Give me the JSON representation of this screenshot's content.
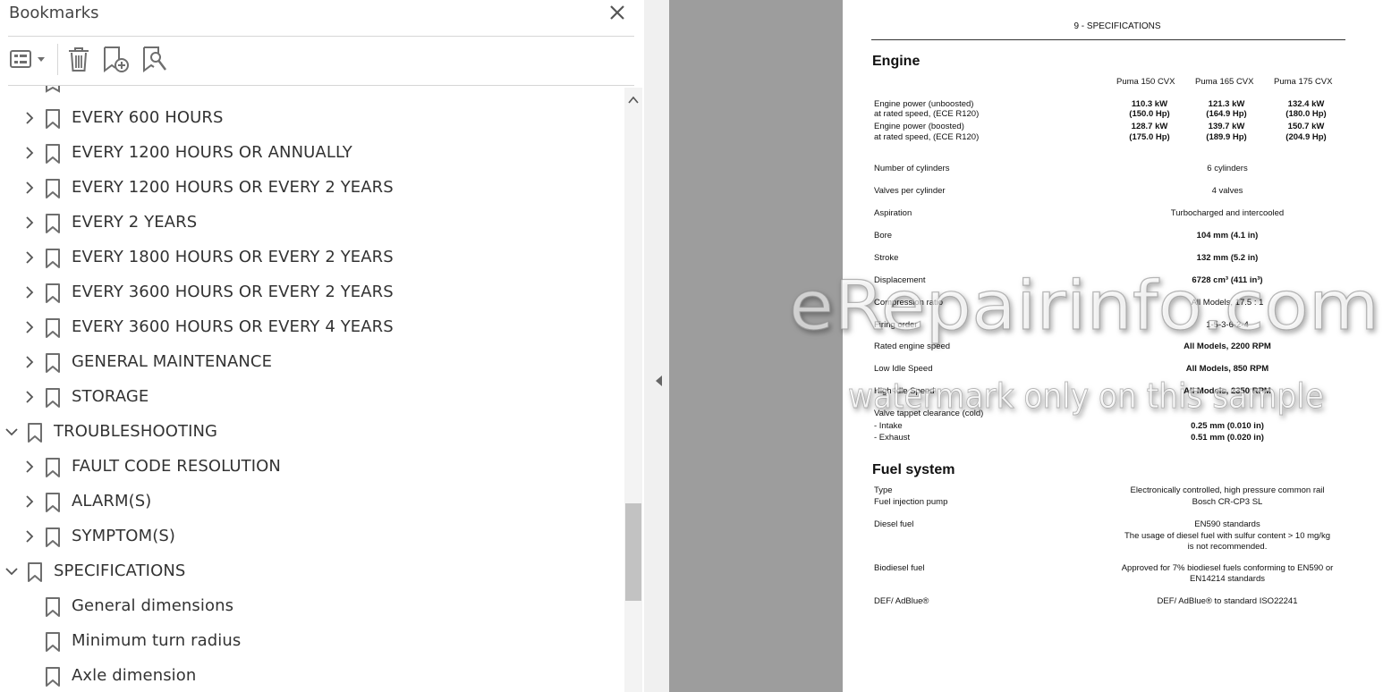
{
  "panel": {
    "title": "Bookmarks",
    "items": [
      {
        "label": "EVERY 600 HOURS",
        "level": 1,
        "expander": "collapsed"
      },
      {
        "label": "EVERY 1200 HOURS OR ANNUALLY",
        "level": 1,
        "expander": "collapsed"
      },
      {
        "label": "EVERY 1200 HOURS OR EVERY 2 YEARS",
        "level": 1,
        "expander": "collapsed"
      },
      {
        "label": "EVERY 2 YEARS",
        "level": 1,
        "expander": "collapsed"
      },
      {
        "label": "EVERY 1800 HOURS OR EVERY 2 YEARS",
        "level": 1,
        "expander": "collapsed"
      },
      {
        "label": "EVERY 3600 HOURS OR EVERY 2 YEARS",
        "level": 1,
        "expander": "collapsed"
      },
      {
        "label": "EVERY 3600 HOURS OR EVERY 4 YEARS",
        "level": 1,
        "expander": "collapsed"
      },
      {
        "label": "GENERAL MAINTENANCE",
        "level": 1,
        "expander": "collapsed"
      },
      {
        "label": "STORAGE",
        "level": 1,
        "expander": "collapsed"
      },
      {
        "label": "TROUBLESHOOTING",
        "level": 0,
        "expander": "expanded"
      },
      {
        "label": "FAULT CODE RESOLUTION",
        "level": 1,
        "expander": "collapsed"
      },
      {
        "label": "ALARM(S)",
        "level": 1,
        "expander": "collapsed"
      },
      {
        "label": "SYMPTOM(S)",
        "level": 1,
        "expander": "collapsed"
      },
      {
        "label": "SPECIFICATIONS",
        "level": 0,
        "expander": "expanded"
      },
      {
        "label": "General dimensions",
        "level": 1,
        "expander": "none"
      },
      {
        "label": "Minimum turn radius",
        "level": 1,
        "expander": "none"
      },
      {
        "label": "Axle dimension",
        "level": 1,
        "expander": "none"
      }
    ]
  },
  "colors": {
    "panel_text": "#333333",
    "icon_gray": "#6e6e6e",
    "doc_background": "#9d9d9d"
  },
  "icons": [
    "options-menu-icon",
    "delete-bookmark-icon",
    "new-bookmark-icon",
    "find-bookmark-icon",
    "close-icon",
    "collapse-panel-icon"
  ],
  "doc": {
    "header": "9 - SPECIFICATIONS",
    "engine_heading": "Engine",
    "models": [
      "Puma 150 CVX",
      "Puma 165 CVX",
      "Puma 175 CVX"
    ],
    "power": {
      "unboosted_l1": "Engine power (unboosted)",
      "unboosted_l2": "at rated speed, (ECE R120)",
      "boosted_l1": "Engine power (boosted)",
      "boosted_l2": "at rated speed, (ECE R120)",
      "unboosted_kw": [
        "110.3 kW",
        "121.3 kW",
        "132.4 kW"
      ],
      "unboosted_hp": [
        "(150.0 Hp)",
        "(164.9 Hp)",
        "(180.0 Hp)"
      ],
      "boosted_kw": [
        "128.7 kW",
        "139.7 kW",
        "150.7 kW"
      ],
      "boosted_hp": [
        "(175.0 Hp)",
        "(189.9 Hp)",
        "(204.9 Hp)"
      ]
    },
    "engine_specs": [
      {
        "label": "Number of cylinders",
        "value": "6 cylinders",
        "bold": false
      },
      {
        "label": "Valves per cylinder",
        "value": "4 valves",
        "bold": false
      },
      {
        "label": "Aspiration",
        "value": "Turbocharged and intercooled",
        "bold": false
      },
      {
        "label": "Bore",
        "value": "104 mm (4.1 in)",
        "bold": true
      },
      {
        "label": "Stroke",
        "value": "132 mm (5.2 in)",
        "bold": true
      },
      {
        "label": "Displacement",
        "value": "6728 cm³ (411 in³)",
        "bold": true
      },
      {
        "label": "Compression ratio",
        "value": "All Models, 17.5 : 1",
        "bold": false
      },
      {
        "label": "Firing order",
        "value": "1-5-3-6-2-4",
        "bold": false
      },
      {
        "label": "Rated engine speed",
        "value": "All Models, 2200 RPM",
        "bold": true
      },
      {
        "label": "Low Idle Speed",
        "value": "All Models, 850 RPM",
        "bold": true
      },
      {
        "label": "High Idle Speed",
        "value": "All Models, 2350 RPM",
        "bold": true
      }
    ],
    "valve": {
      "label": "Valve tappet clearance (cold)",
      "intake_label": "- Intake",
      "exhaust_label": "- Exhaust",
      "intake_value": "0.25 mm (0.010 in)",
      "exhaust_value": "0.51 mm (0.020 in)"
    },
    "fuel_heading": "Fuel system",
    "fuel": {
      "type_label": "Type",
      "type_value": "Electronically controlled, high pressure common rail",
      "pump_label": "Fuel injection pump",
      "pump_value": "Bosch CR-CP3 SL",
      "diesel_label": "Diesel fuel",
      "diesel_value1": "EN590 standards",
      "diesel_value2": "The usage of diesel fuel with sulfur content > 10 mg/kg",
      "diesel_value3": "is not recommended.",
      "bio_label": "Biodiesel fuel",
      "bio_value1": "Approved for 7% biodiesel fuels conforming to EN590 or",
      "bio_value2": "EN14214 standards",
      "def_label": "DEF/ AdBlue®",
      "def_value": "DEF/ AdBlue® to standard ISO22241"
    }
  },
  "watermark": {
    "line1": "eRepairinfo.com",
    "line2": "watermark only on this sample"
  }
}
